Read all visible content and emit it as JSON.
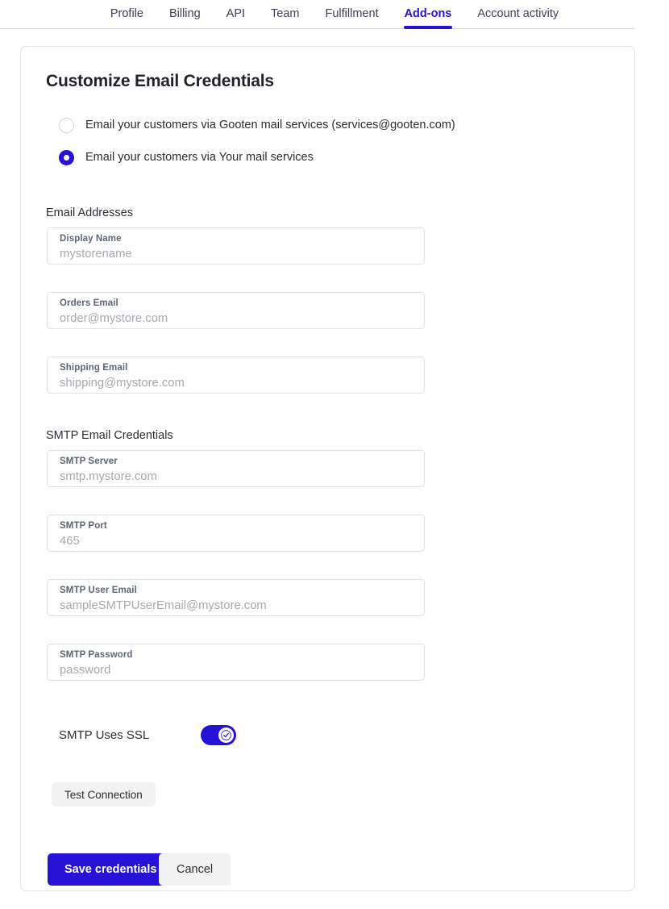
{
  "nav": {
    "tabs": [
      {
        "label": "Profile",
        "active": false
      },
      {
        "label": "Billing",
        "active": false
      },
      {
        "label": "API",
        "active": false
      },
      {
        "label": "Team",
        "active": false
      },
      {
        "label": "Fulfillment",
        "active": false
      },
      {
        "label": "Add-ons",
        "active": true
      },
      {
        "label": "Account activity",
        "active": false
      }
    ]
  },
  "card": {
    "title": "Customize Email Credentials",
    "mail_service_options": [
      {
        "label": "Email your customers via Gooten mail services (services@gooten.com)",
        "selected": false
      },
      {
        "label": "Email your customers via Your mail services",
        "selected": true
      }
    ],
    "sections": {
      "email_addresses": {
        "heading": "Email Addresses",
        "fields": [
          {
            "label": "Display Name",
            "value": "mystorename"
          },
          {
            "label": "Orders Email",
            "value": "order@mystore.com"
          },
          {
            "label": "Shipping Email",
            "value": "shipping@mystore.com"
          }
        ]
      },
      "smtp_credentials": {
        "heading": "SMTP Email Credentials",
        "fields": [
          {
            "label": "SMTP Server",
            "value": "smtp.mystore.com"
          },
          {
            "label": "SMTP Port",
            "value": "465"
          },
          {
            "label": "SMTP User Email",
            "value": "sampleSMTPUserEmail@mystore.com"
          },
          {
            "label": "SMTP Password",
            "value": "password"
          }
        ]
      }
    },
    "ssl": {
      "label": "SMTP Uses SSL",
      "enabled": true,
      "toggle_icon": "check-icon"
    },
    "buttons": {
      "test_connection": "Test Connection",
      "save": "Save credentials",
      "cancel": "Cancel"
    }
  },
  "colors": {
    "accent": "#2611d6",
    "text": "#2c2c34",
    "field_label": "#5e6573",
    "field_value": "#a6a9b0",
    "border": "#e0e0e4",
    "button_secondary_bg": "#f2f2f3"
  }
}
